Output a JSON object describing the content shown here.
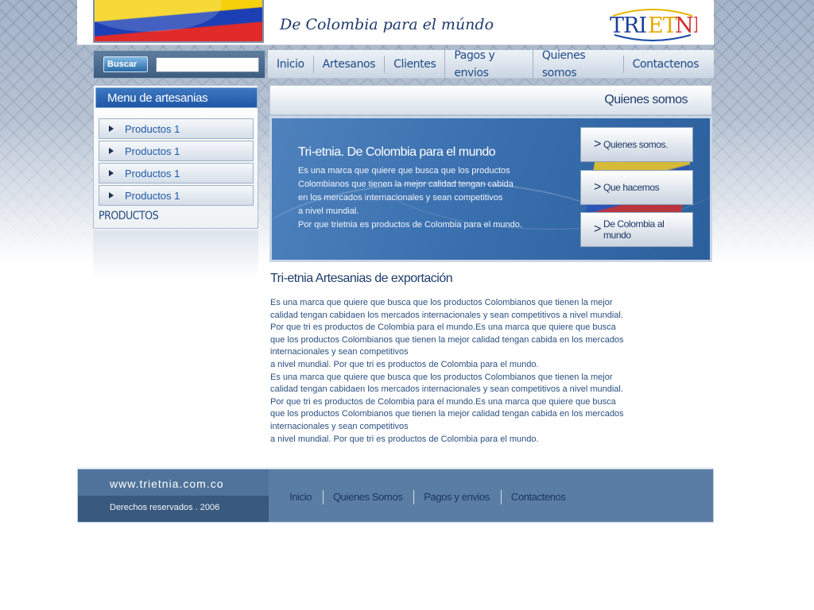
{
  "header": {
    "tagline": "De Colombia para el múndo",
    "logo_text": "TRIETNIA"
  },
  "search": {
    "button_label": "Buscar",
    "value": "",
    "placeholder": ""
  },
  "nav": {
    "items": [
      "Inicio",
      "Artesanos",
      "Clientes",
      "Pagos y envios",
      "Quienes somos",
      "Contactenos"
    ]
  },
  "sidebar": {
    "title": "Menu de artesanias",
    "items": [
      {
        "label": "Productos 1"
      },
      {
        "label": "Productos 1"
      },
      {
        "label": "Productos 1"
      },
      {
        "label": "Productos 1"
      }
    ],
    "footer": "PRODUCTOS"
  },
  "section": {
    "title": "Quienes somos"
  },
  "banner": {
    "title": "Tri-etnia. De Colombia para el mundo",
    "lines": [
      "Es una marca que quiere que busca que los productos",
      "Colombianos que tienen la mejor calidad tengan cabida",
      "en los mercados internacionales y sean competitivos",
      "a nivel mundial.",
      "Por que trietnia es productos de Colombia para el mundo."
    ],
    "buttons": [
      {
        "label": "Quienes somos."
      },
      {
        "label": "Que hacemos"
      },
      {
        "label": "De Colombia al mundo"
      }
    ]
  },
  "article": {
    "title": "Tri-etnia Artesanias de exportación",
    "lines": [
      "Es una marca que quiere que busca que los productos Colombianos que tienen la mejor",
      "calidad tengan cabidaen los mercados internacionales y sean competitivos a nivel mundial.",
      "Por que tri es productos de Colombia para el mundo.Es una marca que quiere que busca",
      "que los productos Colombianos que tienen la mejor calidad tengan cabida en los mercados",
      "internacionales y sean competitivos",
      "a nivel mundial. Por que tri es productos de Colombia para el mundo.",
      "Es una marca que quiere que busca que los productos Colombianos que tienen la mejor",
      "calidad tengan cabidaen los mercados internacionales y sean competitivos a nivel mundial.",
      "Por que tri es productos de Colombia para el mundo.Es una marca que quiere que busca",
      "que los productos Colombianos que tienen la mejor calidad tengan cabida en los mercados",
      "internacionales y sean competitivos",
      "a nivel mundial. Por que tri es productos de Colombia para el mundo."
    ]
  },
  "footer": {
    "url": "www.trietnia.com.co",
    "rights": "Derechos reservados . 2006",
    "nav": [
      "Inicio",
      "Quienes Somos",
      "Pagos y envios",
      "Contactenos"
    ]
  },
  "colors": {
    "accent": "#1f57a4",
    "nav_text": "#1f4b86",
    "footer_bg": "#5a7ea3"
  }
}
